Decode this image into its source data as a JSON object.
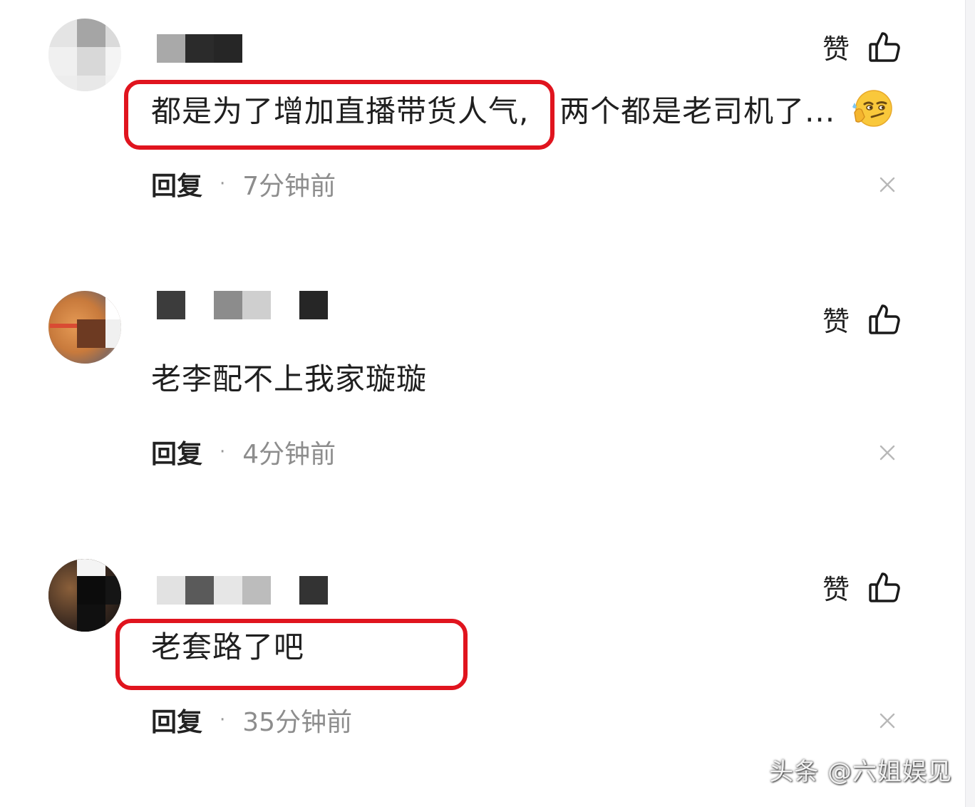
{
  "comments": [
    {
      "text_highlighted": "都是为了增加直播带货人气,",
      "text_rest": "两个都是老司机了...",
      "emoji": "smirk-face-emoji",
      "like_label": "赞",
      "reply_label": "回复",
      "separator": "·",
      "time": "7分钟前"
    },
    {
      "text_plain": "老李配不上我家璇璇",
      "like_label": "赞",
      "reply_label": "回复",
      "separator": "·",
      "time": "4分钟前"
    },
    {
      "text_highlighted": "老套路了吧",
      "like_label": "赞",
      "reply_label": "回复",
      "separator": "·",
      "time": "35分钟前"
    }
  ],
  "watermark": "头条 @六姐娱见",
  "colors": {
    "highlight_border": "#e0141e",
    "time_text": "#8d8d8d",
    "body_text": "#1f1f1f"
  }
}
